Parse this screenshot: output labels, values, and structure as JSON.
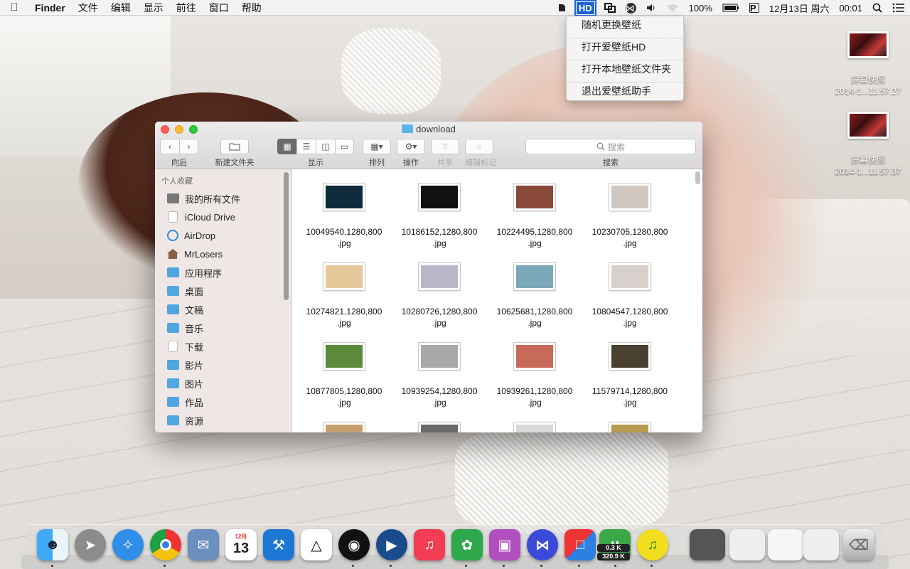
{
  "menubar": {
    "app_name": "Finder",
    "menus": [
      "文件",
      "编辑",
      "显示",
      "前往",
      "窗口",
      "帮助"
    ],
    "status": {
      "hd_label": "HD",
      "box_label": "P",
      "battery": "100%",
      "date": "12月13日 周六",
      "time": "00:01"
    }
  },
  "dropdown": {
    "items": [
      "随机更换壁纸",
      "打开爱壁纸HD",
      "打开本地壁纸文件夹",
      "退出爱壁纸助手"
    ]
  },
  "desktop": {
    "icons": [
      {
        "label1": "屏幕快照",
        "label2": "2014-1...11.57.27"
      },
      {
        "label1": "屏幕快照",
        "label2": "2014-1...11.57.37"
      }
    ]
  },
  "finder": {
    "title": "download",
    "toolbar": {
      "back_label": "向后",
      "new_folder_label": "新建文件夹",
      "view_label": "显示",
      "arrange_label": "排列",
      "action_label": "操作",
      "share_label": "共享",
      "tags_label": "编辑标记",
      "search_placeholder": "搜索",
      "search_label": "搜索"
    },
    "sidebar": {
      "heading": "个人收藏",
      "items": [
        "我的所有文件",
        "iCloud Drive",
        "AirDrop",
        "MrLosers",
        "应用程序",
        "桌面",
        "文稿",
        "音乐",
        "下载",
        "影片",
        "图片",
        "作品",
        "资源"
      ]
    },
    "files": [
      {
        "name1": "10049540,1280,800",
        "name2": ".jpg",
        "color": "#0f2a3a"
      },
      {
        "name1": "10186152,1280,800",
        "name2": ".jpg",
        "color": "#111111"
      },
      {
        "name1": "10224495,1280,800",
        "name2": ".jpg",
        "color": "#8a4a3a"
      },
      {
        "name1": "10230705,1280,800",
        "name2": ".jpg",
        "color": "#d0c8c0"
      },
      {
        "name1": "10274821,1280,800",
        "name2": ".jpg",
        "color": "#e6c89a"
      },
      {
        "name1": "10280726,1280,800",
        "name2": ".jpg",
        "color": "#b8b8c8"
      },
      {
        "name1": "10625681,1280,800",
        "name2": ".jpg",
        "color": "#7aa8b8"
      },
      {
        "name1": "10804547,1280,800",
        "name2": ".jpg",
        "color": "#d8d0cc"
      },
      {
        "name1": "10877805,1280,800",
        "name2": ".jpg",
        "color": "#5a8a3a"
      },
      {
        "name1": "10939254,1280,800",
        "name2": ".jpg",
        "color": "#a8a8a8"
      },
      {
        "name1": "10939261,1280,800",
        "name2": ".jpg",
        "color": "#c86a5a"
      },
      {
        "name1": "11579714,1280,800",
        "name2": ".jpg",
        "color": "#4a4030"
      }
    ]
  },
  "dock": {
    "calendar_month": "12月",
    "calendar_day": "13",
    "net_up": "0.3 K",
    "net_down": "320.9 K"
  }
}
